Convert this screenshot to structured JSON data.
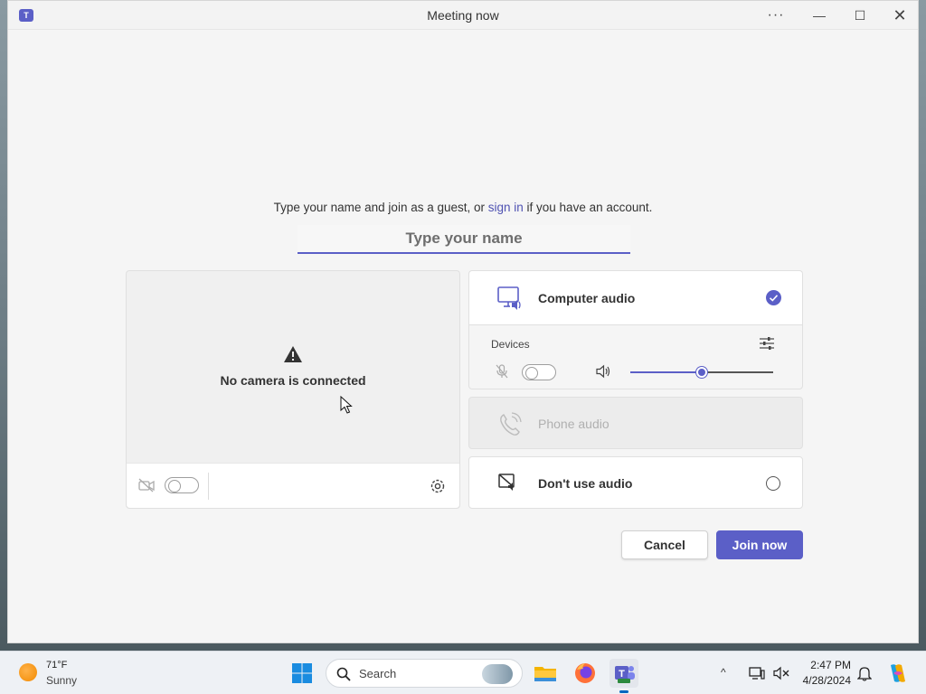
{
  "window": {
    "title": "Meeting now",
    "more_label": "···",
    "minimize_label": "—",
    "maximize_label": "☐",
    "close_label": "✕"
  },
  "join": {
    "prompt_before": "Type your name and join as a guest, or ",
    "sign_in_link": "sign in",
    "prompt_after": " if you have an account.",
    "name_placeholder": "Type your name"
  },
  "camera": {
    "no_camera_text": "No camera is connected",
    "camera_on": false
  },
  "audio": {
    "computer_audio_label": "Computer audio",
    "computer_audio_selected": true,
    "devices_label": "Devices",
    "mic_on": false,
    "speaker_volume_fraction": 0.5,
    "phone_audio_label": "Phone audio",
    "no_audio_label": "Don't use audio"
  },
  "buttons": {
    "cancel": "Cancel",
    "join_now": "Join now"
  },
  "colors": {
    "accent": "#5b5fc7",
    "link": "#4f52b2"
  },
  "taskbar": {
    "weather_temp": "71°F",
    "weather_condition": "Sunny",
    "search_label": "Search",
    "time": "2:47 PM",
    "date": "4/28/2024",
    "tray_chevron": "^"
  }
}
